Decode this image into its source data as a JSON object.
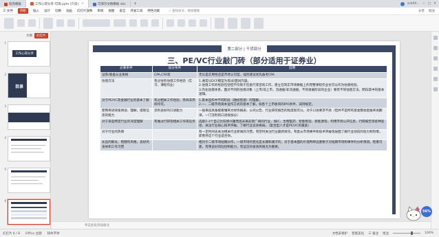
{
  "tabs": [
    {
      "label": "稻壳模板",
      "color": "#c6432c",
      "active": false
    },
    {
      "label": "工作心得分享-可演.pptx (只读)",
      "color": "#d35b3c",
      "active": true
    },
    {
      "label": "可演示文稿模板.doc",
      "color": "#3f6fd0",
      "active": false
    }
  ],
  "tab_add": "+",
  "user": "sck44...",
  "menu": {
    "file": "三 文件",
    "items": [
      "开始",
      "插入",
      "设计",
      "切换",
      "动画",
      "幻灯片放映",
      "审阅",
      "视图",
      "安全",
      "开发工具",
      "特色功能"
    ],
    "active_index": 0,
    "search": "查找命令、搜索模板",
    "right": [
      "分享",
      "批注"
    ]
  },
  "left_panel": {
    "outline_label": "大纲",
    "slides_label": "幻灯片",
    "thumbs": [
      {
        "num": "1",
        "title": "工作心得分享"
      },
      {
        "num": "2",
        "title": "目录"
      },
      {
        "num": "3",
        "title": ""
      },
      {
        "num": "4",
        "title": ""
      },
      {
        "num": "5",
        "title": ""
      },
      {
        "num": "6",
        "title": ""
      }
    ],
    "selected_index": 5
  },
  "slide": {
    "band": "第二部分 | 干货部分",
    "title": "三、PE/VC行业敲门砖（部分适用于证券业）",
    "headers": [
      "必要条件",
      "加分条件",
      "说明"
    ],
    "rows": [
      [
        "证券/基金从业资格",
        "CPA,CFA等",
        "无论是实用性还是市场认可度，强烈建议优先备考CPA"
      ],
      [
        "估值方法",
        "有过往的估值工作经验（实习、课程作业）",
        "1.通常以DCF模型为笔试/面试内容。\n2.估值工作的经验包括但不仅限于在投行或咨询工作，建立在现实市场数据上的完整课程作业也可以作为估值经验。\n3.内化估值体系，面对不同的估值对象（上市/非上市，流通股/非流通股，不同发展阶段的企业）要有不同估值方法，明白其中的基本逻辑。"
      ],
      [
        "对于PE/VC及金融行业的基本了解",
        "有过相关工作经验，券商非券商均可。",
        "1.基本运作中不同阶段（融投管退）的理解。\n2.一、二级市场资本运作方式的基本了解，如各个上市板块的IPO条件、减持规定。"
      ],
      [
        "使用英语快速阅读、理解，提取信息的能力",
        "流利良好的口语能力",
        "一般来说具备能看懂英文财务报表、公司公告、行业研究报告的程度就可以，对于口语要求不高（但并不是所有基金都会配备英语翻译，一门流利的口语很加分）"
      ],
      [
        "对于某些特定行业的深度理解",
        "有做过行研等相关工作或任务",
        "选取1-3个自己比较感兴趣而且未来前景广阔的行业，如IC、生物医药、智能制造、新能源等，利用市场公开信息，行研报告等各种途径，关注行业核心技术突破，了解行业竞争格局。（复合型人才是PE/VC的最爱）"
      ],
      [
        "对于行业的热情",
        "",
        "有一定时间去关注相关行业新闻的习惯，有空时关注行业最新资讯，有意从市场事件和技术突破等层面了解行业动向的动力和热情，即善存这个行业适合你。"
      ],
      [
        "长远的眼光、稳健的风格，良好的身体和工作习惯",
        "",
        "相对于二级市场短期炒作，一级市场的变化是长期和潮汐的，对于基本面的价值判断远重要于对短期市场和事件的分析预测。稳重可靠，有用良好风险控制能力，有远见的投资风格尤为重要。"
      ]
    ]
  },
  "notes_placeholder": "单击此处添加备注",
  "status": {
    "slide_of": "幻灯片 6 / 8",
    "theme": "Office 主题",
    "missing_font": "缺失字体",
    "right": [
      "文档未保护",
      "智能美化",
      "三 备注",
      "批注"
    ],
    "zoom": "100%"
  },
  "badge": "56%",
  "colors": {
    "accent": "#c6432c",
    "slide_navy": "#3b4865"
  }
}
